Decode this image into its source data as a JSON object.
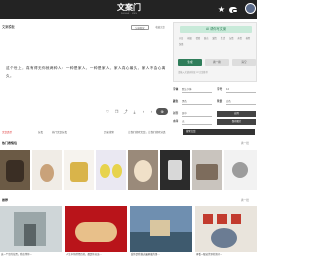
{
  "header": {
    "logo": "文案门",
    "logo_sub": "WENAN · MEN",
    "icons": [
      "star-icon",
      "chat-icon",
      "avatar"
    ]
  },
  "text_card": {
    "title": "文案模板",
    "button_outline": "分享图文",
    "button_plain": "收藏文案",
    "quote": "这个世上，真有得无你就两种人：一种是家人，一种是家人，家人真心最久，家人不会心离久。",
    "tools": [
      "heart-icon",
      "copy-icon",
      "share-icon",
      "download-icon",
      "chevron-icon",
      "more-icon"
    ],
    "tool_active": "⊕"
  },
  "ai_panel": {
    "title": "AI 帮你写文案",
    "tags": [
      "节日",
      "祝福",
      "情感",
      "励志",
      "爱情",
      "生活",
      "友情",
      "亲情",
      "搞笑",
      "伤感"
    ],
    "buttons": [
      "生成",
      "换一换",
      "清空"
    ],
    "note": "请输入关键词获取 AI 文案推荐"
  },
  "form": {
    "row1": {
      "label1": "字体",
      "value1": "默认字体",
      "label2": "字号",
      "value2": "12"
    },
    "row2": {
      "label1": "颜色",
      "value1": "黑色",
      "label2": "背景",
      "value2": "白色"
    },
    "row3": {
      "label1": "对齐",
      "value1": "居中",
      "button": "应用"
    },
    "row4": {
      "label1": "水印",
      "value1": "无",
      "button": "保存图片"
    }
  },
  "strip": {
    "item1": "文案类型",
    "item2": "分类",
    "item3": "热门文案分类",
    "item4": "历史搜索",
    "tag1": "搜索文案",
    "item5": "让我们搜索文案，让我们搜索分类",
    "search": "搜索文案"
  },
  "section1": {
    "title": "热门表情包",
    "more": "换一批",
    "tiles": [
      "",
      "",
      "",
      "",
      "",
      "",
      "",
      ""
    ]
  },
  "section2": {
    "title": "推荐",
    "more": "换一批",
    "captions": [
      "这一个空的位置，我在等你…",
      "人生中你所经历的，都是你应该…",
      "爱你是我做过最勇敢的事…",
      "再看一眼这世界的美好…"
    ]
  },
  "colors": {
    "header_bg": "#232323",
    "accent": "#2f7d5a",
    "ai_title_bg": "#c8ead9"
  }
}
